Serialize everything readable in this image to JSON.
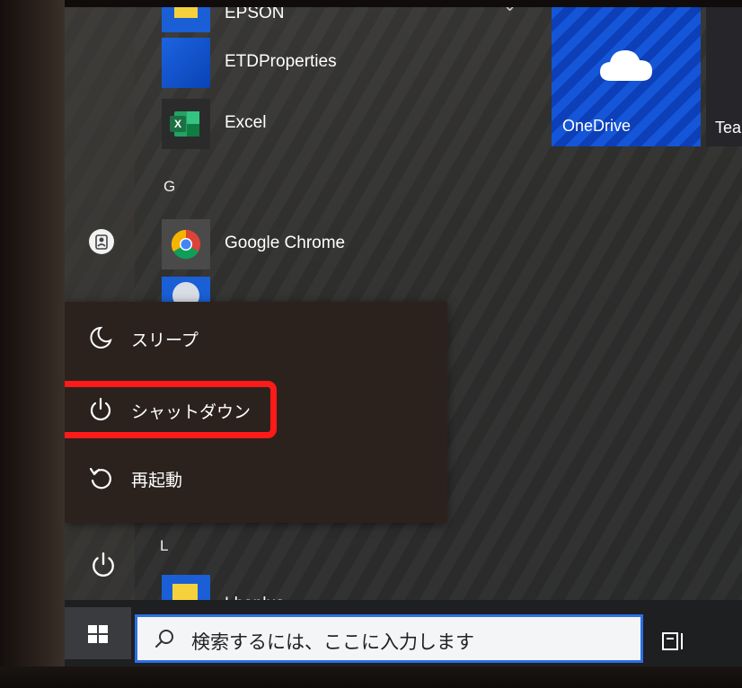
{
  "start_menu": {
    "apps": [
      {
        "label": "EPSON",
        "icon": "epson-icon"
      },
      {
        "label": "ETDProperties",
        "icon": "etd-properties-icon"
      },
      {
        "label": "Excel",
        "icon": "excel-icon"
      },
      {
        "label": "Google Chrome",
        "icon": "chrome-icon"
      },
      {
        "label": "",
        "icon": "google-app-icon"
      },
      {
        "label": "Lhaplus",
        "icon": "lhaplus-icon"
      }
    ],
    "sections": {
      "g": "G",
      "l": "L"
    },
    "tiles": [
      {
        "label": "OneDrive",
        "icon": "onedrive-cloud-icon"
      },
      {
        "label": "Tea",
        "icon": ""
      }
    ]
  },
  "power_menu": {
    "items": [
      {
        "label": "スリープ",
        "icon": "sleep-moon-icon"
      },
      {
        "label": "シャットダウン",
        "icon": "power-icon",
        "highlighted": true
      },
      {
        "label": "再起動",
        "icon": "restart-icon"
      }
    ]
  },
  "taskbar": {
    "search_placeholder": "検索するには、ここに入力します",
    "start_icon": "windows-logo-icon",
    "task_view_icon": "task-view-icon"
  },
  "colors": {
    "highlight": "#ff1a1a",
    "tile_blue": "#1556d8",
    "search_border": "#2c6fe6",
    "excel_green": "#1d7044"
  }
}
